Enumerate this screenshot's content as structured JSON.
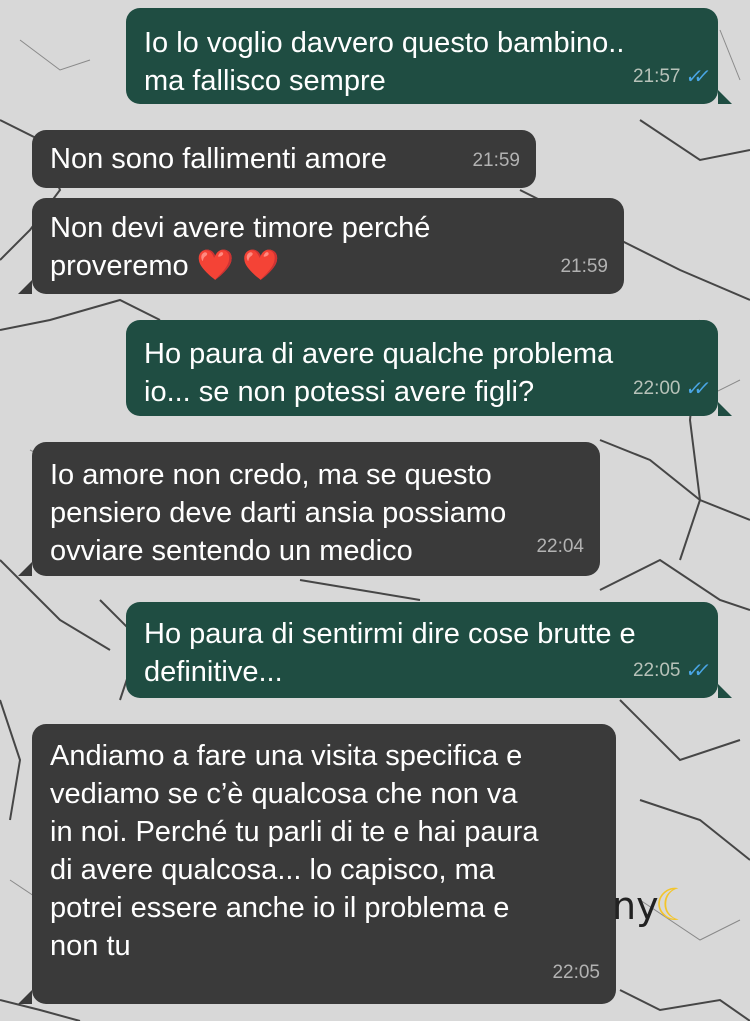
{
  "colors": {
    "outgoing_bubble": "#1f4d42",
    "incoming_bubble": "#3a3a3a",
    "read_ticks": "#4aa6e6",
    "heart": "#e8212b",
    "moon": "#f3c52b"
  },
  "messages": [
    {
      "direction": "outgoing",
      "text": "Io lo voglio davvero questo bambino..\nma fallisco sempre",
      "time": "21:57",
      "read": true
    },
    {
      "direction": "incoming",
      "text": "Non sono fallimenti amore",
      "time": "21:59"
    },
    {
      "direction": "incoming",
      "text": "Non devi avere timore perché\nproveremo",
      "emoji": "❤️ ❤️",
      "time": "21:59"
    },
    {
      "direction": "outgoing",
      "text": "Ho paura di avere qualche problema\nio... se non potessi avere figli?",
      "time": "22:00",
      "read": true
    },
    {
      "direction": "incoming",
      "text": "Io amore non credo, ma se questo\npensiero deve darti ansia possiamo\novviare sentendo un medico",
      "time": "22:04"
    },
    {
      "direction": "outgoing",
      "text": "Ho paura di sentirmi dire cose brutte e\ndefinitive...",
      "time": "22:05",
      "read": true
    },
    {
      "direction": "incoming",
      "text": "Andiamo a fare una visita specifica e\nvediamo se c’è qualcosa che non va\nin noi. Perché tu parli di te e hai paura\ndi avere qualcosa... lo capisco, ma\npotrei essere anche io il problema e\nnon tu",
      "time": "22:05"
    }
  ],
  "watermark": {
    "text": "ny",
    "icon": "crescent-moon-icon"
  }
}
